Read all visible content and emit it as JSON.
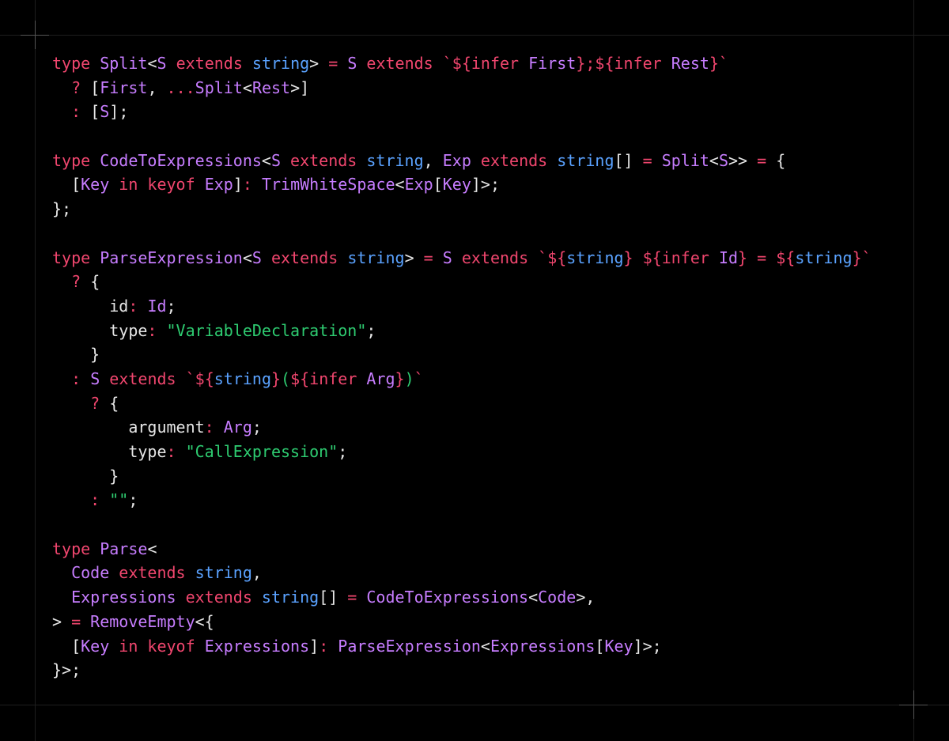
{
  "colors": {
    "background": "#000000",
    "keyword": "#f0466e",
    "type_name": "#c77dff",
    "primitive": "#5aa2ff",
    "string": "#2ecc71",
    "punctuation": "#e6e6e6",
    "frame_line": "#1e1e1e",
    "crosshair": "#555555"
  },
  "code_lines": [
    [
      [
        "kw",
        "type "
      ],
      [
        "type",
        "Split"
      ],
      [
        "punc",
        "<"
      ],
      [
        "type",
        "S"
      ],
      [
        "kw",
        " extends "
      ],
      [
        "prim",
        "string"
      ],
      [
        "punc",
        ">"
      ],
      [
        "op",
        " = "
      ],
      [
        "type",
        "S"
      ],
      [
        "kw",
        " extends "
      ],
      [
        "kw",
        "`${"
      ],
      [
        "kw",
        "infer "
      ],
      [
        "type",
        "First"
      ],
      [
        "kw",
        "};${"
      ],
      [
        "kw",
        "infer "
      ],
      [
        "type",
        "Rest"
      ],
      [
        "kw",
        "}`"
      ]
    ],
    [
      [
        "plain",
        "  "
      ],
      [
        "op",
        "? "
      ],
      [
        "punc",
        "["
      ],
      [
        "type",
        "First"
      ],
      [
        "punc",
        ", "
      ],
      [
        "op",
        "..."
      ],
      [
        "type",
        "Split"
      ],
      [
        "punc",
        "<"
      ],
      [
        "type",
        "Rest"
      ],
      [
        "punc",
        ">]"
      ]
    ],
    [
      [
        "plain",
        "  "
      ],
      [
        "op",
        ": "
      ],
      [
        "punc",
        "["
      ],
      [
        "type",
        "S"
      ],
      [
        "punc",
        "];"
      ]
    ],
    [],
    [
      [
        "kw",
        "type "
      ],
      [
        "type",
        "CodeToExpressions"
      ],
      [
        "punc",
        "<"
      ],
      [
        "type",
        "S"
      ],
      [
        "kw",
        " extends "
      ],
      [
        "prim",
        "string"
      ],
      [
        "punc",
        ", "
      ],
      [
        "type",
        "Exp"
      ],
      [
        "kw",
        " extends "
      ],
      [
        "prim",
        "string"
      ],
      [
        "punc",
        "[]"
      ],
      [
        "op",
        " = "
      ],
      [
        "type",
        "Split"
      ],
      [
        "punc",
        "<"
      ],
      [
        "type",
        "S"
      ],
      [
        "punc",
        ">>"
      ],
      [
        "op",
        " = "
      ],
      [
        "punc",
        "{"
      ]
    ],
    [
      [
        "plain",
        "  "
      ],
      [
        "punc",
        "["
      ],
      [
        "type",
        "Key"
      ],
      [
        "kw",
        " in keyof "
      ],
      [
        "type",
        "Exp"
      ],
      [
        "punc",
        "]"
      ],
      [
        "op",
        ": "
      ],
      [
        "type",
        "TrimWhiteSpace"
      ],
      [
        "punc",
        "<"
      ],
      [
        "type",
        "Exp"
      ],
      [
        "punc",
        "["
      ],
      [
        "type",
        "Key"
      ],
      [
        "punc",
        "]>;"
      ]
    ],
    [
      [
        "punc",
        "};"
      ]
    ],
    [],
    [
      [
        "kw",
        "type "
      ],
      [
        "type",
        "ParseExpression"
      ],
      [
        "punc",
        "<"
      ],
      [
        "type",
        "S"
      ],
      [
        "kw",
        " extends "
      ],
      [
        "prim",
        "string"
      ],
      [
        "punc",
        ">"
      ],
      [
        "op",
        " = "
      ],
      [
        "type",
        "S"
      ],
      [
        "kw",
        " extends "
      ],
      [
        "kw",
        "`${"
      ],
      [
        "prim",
        "string"
      ],
      [
        "kw",
        "} ${"
      ],
      [
        "kw",
        "infer "
      ],
      [
        "type",
        "Id"
      ],
      [
        "kw",
        "}"
      ],
      [
        "op",
        " = "
      ],
      [
        "kw",
        "${"
      ],
      [
        "prim",
        "string"
      ],
      [
        "kw",
        "}`"
      ]
    ],
    [
      [
        "plain",
        "  "
      ],
      [
        "op",
        "? "
      ],
      [
        "punc",
        "{"
      ]
    ],
    [
      [
        "plain",
        "      "
      ],
      [
        "plain",
        "id"
      ],
      [
        "op",
        ": "
      ],
      [
        "type",
        "Id"
      ],
      [
        "punc",
        ";"
      ]
    ],
    [
      [
        "plain",
        "      "
      ],
      [
        "plain",
        "type"
      ],
      [
        "op",
        ": "
      ],
      [
        "str",
        "\"VariableDeclaration\""
      ],
      [
        "punc",
        ";"
      ]
    ],
    [
      [
        "plain",
        "    "
      ],
      [
        "punc",
        "}"
      ]
    ],
    [
      [
        "plain",
        "  "
      ],
      [
        "op",
        ": "
      ],
      [
        "type",
        "S"
      ],
      [
        "kw",
        " extends "
      ],
      [
        "kw",
        "`${"
      ],
      [
        "prim",
        "string"
      ],
      [
        "kw",
        "}"
      ],
      [
        "str",
        "("
      ],
      [
        "kw",
        "${"
      ],
      [
        "kw",
        "infer "
      ],
      [
        "type",
        "Arg"
      ],
      [
        "kw",
        "}"
      ],
      [
        "str",
        ")"
      ],
      [
        "kw",
        "`"
      ]
    ],
    [
      [
        "plain",
        "    "
      ],
      [
        "op",
        "? "
      ],
      [
        "punc",
        "{"
      ]
    ],
    [
      [
        "plain",
        "        "
      ],
      [
        "plain",
        "argument"
      ],
      [
        "op",
        ": "
      ],
      [
        "type",
        "Arg"
      ],
      [
        "punc",
        ";"
      ]
    ],
    [
      [
        "plain",
        "        "
      ],
      [
        "plain",
        "type"
      ],
      [
        "op",
        ": "
      ],
      [
        "str",
        "\"CallExpression\""
      ],
      [
        "punc",
        ";"
      ]
    ],
    [
      [
        "plain",
        "      "
      ],
      [
        "punc",
        "}"
      ]
    ],
    [
      [
        "plain",
        "    "
      ],
      [
        "op",
        ": "
      ],
      [
        "str",
        "\"\""
      ],
      [
        "punc",
        ";"
      ]
    ],
    [],
    [
      [
        "kw",
        "type "
      ],
      [
        "type",
        "Parse"
      ],
      [
        "punc",
        "<"
      ]
    ],
    [
      [
        "plain",
        "  "
      ],
      [
        "type",
        "Code"
      ],
      [
        "kw",
        " extends "
      ],
      [
        "prim",
        "string"
      ],
      [
        "punc",
        ","
      ]
    ],
    [
      [
        "plain",
        "  "
      ],
      [
        "type",
        "Expressions"
      ],
      [
        "kw",
        " extends "
      ],
      [
        "prim",
        "string"
      ],
      [
        "punc",
        "[]"
      ],
      [
        "op",
        " = "
      ],
      [
        "type",
        "CodeToExpressions"
      ],
      [
        "punc",
        "<"
      ],
      [
        "type",
        "Code"
      ],
      [
        "punc",
        ">,"
      ]
    ],
    [
      [
        "punc",
        ">"
      ],
      [
        "op",
        " = "
      ],
      [
        "type",
        "RemoveEmpty"
      ],
      [
        "punc",
        "<{"
      ]
    ],
    [
      [
        "plain",
        "  "
      ],
      [
        "punc",
        "["
      ],
      [
        "type",
        "Key"
      ],
      [
        "kw",
        " in keyof "
      ],
      [
        "type",
        "Expressions"
      ],
      [
        "punc",
        "]"
      ],
      [
        "op",
        ": "
      ],
      [
        "type",
        "ParseExpression"
      ],
      [
        "punc",
        "<"
      ],
      [
        "type",
        "Expressions"
      ],
      [
        "punc",
        "["
      ],
      [
        "type",
        "Key"
      ],
      [
        "punc",
        "]>;"
      ]
    ],
    [
      [
        "punc",
        "}>;"
      ]
    ]
  ]
}
